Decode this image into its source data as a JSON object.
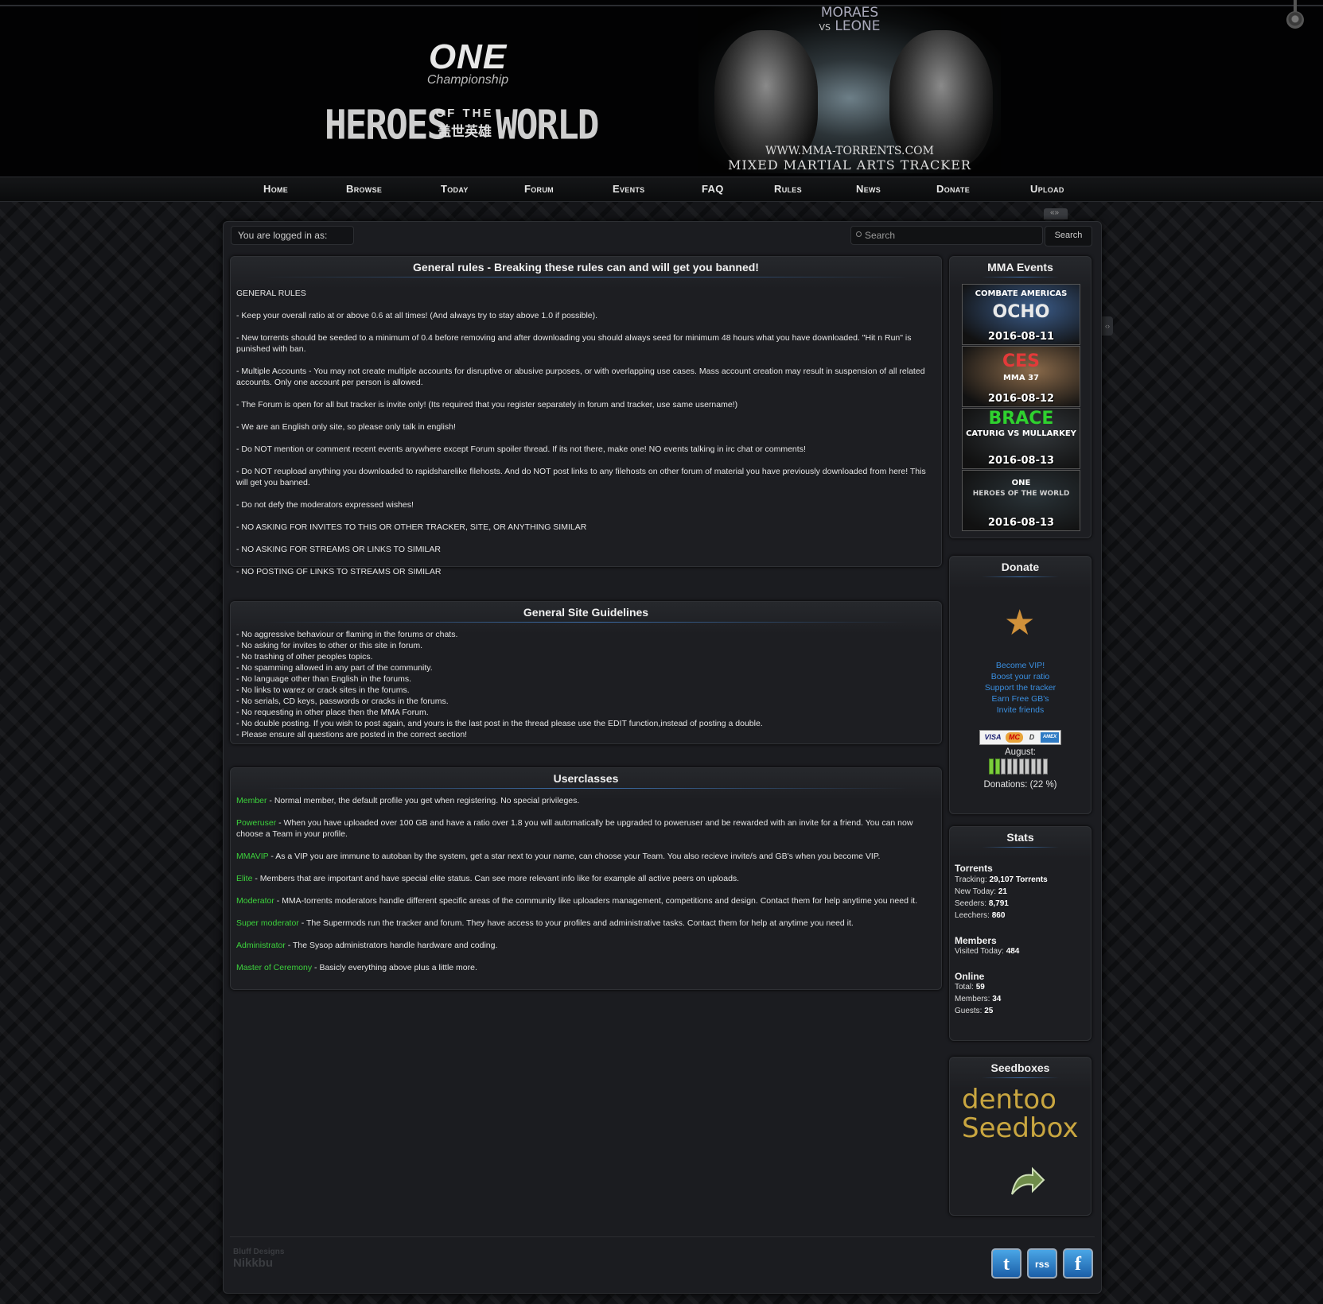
{
  "header": {
    "one_logo": "ONE",
    "one_subtitle": "Championship",
    "heroes_left": "HEROES",
    "of_the": "OF THE",
    "chinese_title": "盖世英雄",
    "heroes_right": "WORLD",
    "poster_fighter_1": "MORAES",
    "poster_vs": "VS",
    "poster_fighter_2": "LEONE",
    "site_url": "WWW.MMA-TORRENTS.COM",
    "site_tagline": "MIXED MARTIAL ARTS TRACKER"
  },
  "nav": {
    "items": [
      "Home",
      "Browse",
      "Today",
      "Forum",
      "Events",
      "FAQ",
      "Rules",
      "News",
      "Donate",
      "Upload"
    ]
  },
  "topbar": {
    "logged_in": "You are logged in as:",
    "search_placeholder": "Search",
    "search_button": "Search"
  },
  "rules": {
    "title": "General rules - Breaking these rules can and will get you banned!",
    "paragraphs": [
      "GENERAL RULES",
      "- Keep your overall ratio at or above 0.6 at all times! (And always try to stay above 1.0 if possible).",
      "- New torrents should be seeded to a minimum of 0.4 before removing and after downloading you should always seed for minimum 48 hours what you have downloaded. \"Hit n Run\" is punished with ban.",
      "- Multiple Accounts - You may not create multiple accounts for disruptive or abusive purposes, or with overlapping use cases. Mass account creation may result in suspension of all related accounts. Only one account per person is allowed.",
      "- The Forum is open for all but tracker is invite only! (Its required that you register separately in forum and tracker, use same username!)",
      "- We are an English only site, so please only talk in english!",
      "- Do NOT mention or comment recent events anywhere except Forum spoiler thread. If its not there, make one! NO events talking in irc chat or comments!",
      "- Do NOT reupload anything you downloaded to rapidsharelike filehosts. And do NOT post links to any filehosts on other forum of material you have previously downloaded from here! This will get you banned.",
      "- Do not defy the moderators expressed wishes!",
      "- NO ASKING FOR INVITES TO THIS OR OTHER TRACKER, SITE, OR ANYTHING SIMILAR",
      "- NO ASKING FOR STREAMS OR LINKS TO SIMILAR",
      "- NO POSTING OF LINKS TO STREAMS OR SIMILAR"
    ]
  },
  "guidelines": {
    "title": "General Site Guidelines",
    "lines": [
      "- No aggressive behaviour or flaming in the forums or chats.",
      "- No asking for invites to other or this site in forum.",
      "- No trashing of other peoples topics.",
      "- No spamming allowed in any part of the community.",
      "- No language other than English in the forums.",
      "- No links to warez or crack sites in the forums.",
      "- No serials, CD keys, passwords or cracks in the forums.",
      "- No requesting in other place then the MMA Forum.",
      "- No double posting. If you wish to post again, and yours is the last post in the thread please use the EDIT function,instead of posting a double.",
      "- Please ensure all questions are posted in the correct section!"
    ]
  },
  "userclasses": {
    "title": "Userclasses",
    "items": [
      {
        "name": "Member",
        "desc": " - Normal member, the default profile you get when registering. No special privileges."
      },
      {
        "name": "Poweruser",
        "desc": " - When you have uploaded over 100 GB and have a ratio over 1.8 you will automatically be upgraded to poweruser and be rewarded with an invite for a friend. You can now choose a Team in your profile."
      },
      {
        "name": "MMAVIP",
        "desc": " - As a VIP you are immune to autoban by the system, get a star next to your name, can choose your Team. You also recieve invite/s and GB's when you become VIP."
      },
      {
        "name": "Elite",
        "desc": " - Members that are important and have special elite status. Can see more relevant info like for example all active peers on uploads."
      },
      {
        "name": "Moderator",
        "desc": " - MMA-torrents moderators handle different specific areas of the community like uploaders management, competitions and design. Contact them for help anytime you need it."
      },
      {
        "name": "Super moderator",
        "desc": " - The Supermods run the tracker and forum. They have access to your profiles and administrative tasks. Contact them for help at anytime you need it."
      },
      {
        "name": "Administrator",
        "desc": " - The Sysop administrators handle hardware and coding."
      },
      {
        "name": "Master of Ceremony",
        "desc": " - Basicly everything above plus a little more."
      }
    ]
  },
  "events": {
    "title": "MMA Events",
    "banners": [
      {
        "name": "OCHO",
        "sub": "COMBATE AMERICAS",
        "date": "2016-08-11",
        "color": "#e9e9e9",
        "bg": "#3b5c8a"
      },
      {
        "name": "CES",
        "sub": "MMA 37",
        "date": "2016-08-12",
        "color": "#e23a3a",
        "bg": "#8a6a4a"
      },
      {
        "name": "BRACE",
        "sub": "CATURIG VS MULLARKEY",
        "date": "2016-08-13",
        "color": "#2fd12f",
        "bg": "#33383c"
      },
      {
        "name": "HEROES OF THE WORLD",
        "sub": "ONE",
        "date": "2016-08-13",
        "color": "#cfcfcf",
        "bg": "#2a3338"
      }
    ]
  },
  "donate": {
    "title": "Donate",
    "links": [
      "Become VIP!",
      "Boost your ratio",
      "Support the tracker",
      "Earn Free GB's",
      "Invite friends"
    ],
    "cards": [
      "VISA",
      "MC",
      "D",
      "AMEX"
    ],
    "month": "August:",
    "progress": 0.22,
    "donations_text": "Donations: (22 %)"
  },
  "stats": {
    "title": "Stats",
    "torrents_head": "Torrents",
    "tracking_label": "Tracking: ",
    "tracking_value": "29,107 Torrents",
    "new_today_label": "New Today: ",
    "new_today_value": "21",
    "seeders_label": "Seeders: ",
    "seeders_value": "8,791",
    "leechers_label": "Leechers: ",
    "leechers_value": "860",
    "members_head": "Members",
    "visited_label": "Visited Today: ",
    "visited_value": "484",
    "online_head": "Online",
    "total_label": "Total: ",
    "total_value": "59",
    "members_label": "Members: ",
    "members_value": "34",
    "guests_label": "Guests: ",
    "guests_value": "25"
  },
  "seedboxes": {
    "title": "Seedboxes",
    "line1": "dentoo",
    "line2": "Seedbox"
  },
  "footer": {
    "credit_line1": "Bluff Designs",
    "credit_line2": "Nikkbu",
    "social": [
      "t",
      "rss",
      "f"
    ]
  }
}
